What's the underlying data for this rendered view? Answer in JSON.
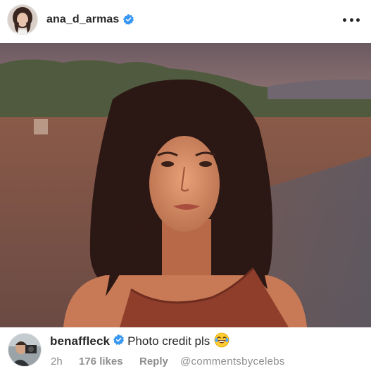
{
  "post": {
    "author": "ana_d_armas",
    "author_verified": true,
    "menu_icon": "more-horizontal-icon"
  },
  "comment": {
    "username": "benaffleck",
    "verified": true,
    "text": "Photo credit pls",
    "emoji": "😂",
    "time": "2h",
    "likes": "176 likes",
    "reply_label": "Reply"
  },
  "watermark": "@commentsbycelebs",
  "colors": {
    "verified_blue": "#3897f0",
    "text_primary": "#262626",
    "text_secondary": "#8e8e8e"
  }
}
